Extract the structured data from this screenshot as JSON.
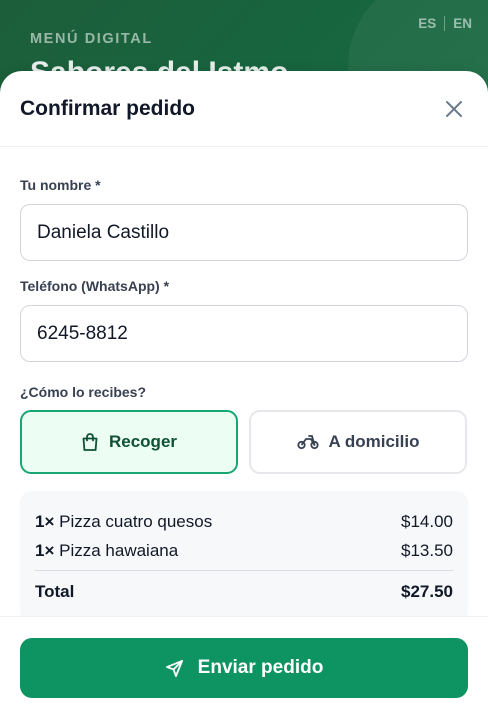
{
  "app": {
    "kicker": "MENÚ DIGITAL",
    "title": "Sabores del Istmo",
    "languages": [
      "ES",
      "EN"
    ]
  },
  "modal": {
    "title": "Confirmar pedido",
    "name_label": "Tu nombre *",
    "name_value": "Daniela Castillo",
    "phone_label": "Teléfono (WhatsApp) *",
    "phone_value": "6245-8812",
    "method_label": "¿Cómo lo recibes?",
    "methods": [
      {
        "label": "Recoger",
        "icon": "shopping-bag-icon",
        "selected": true
      },
      {
        "label": "A domicilio",
        "icon": "scooter-icon",
        "selected": false
      }
    ],
    "items": [
      {
        "qty": "1×",
        "name": "Pizza cuatro quesos",
        "price": "$14.00"
      },
      {
        "qty": "1×",
        "name": "Pizza hawaiana",
        "price": "$13.50"
      }
    ],
    "total_label": "Total",
    "total_value": "$27.50",
    "submit_label": "Enviar pedido"
  },
  "colors": {
    "header_green": "#17653f",
    "accent": "#0e9363",
    "selected_border": "#17a773",
    "selected_bg": "#ecfdf4"
  }
}
